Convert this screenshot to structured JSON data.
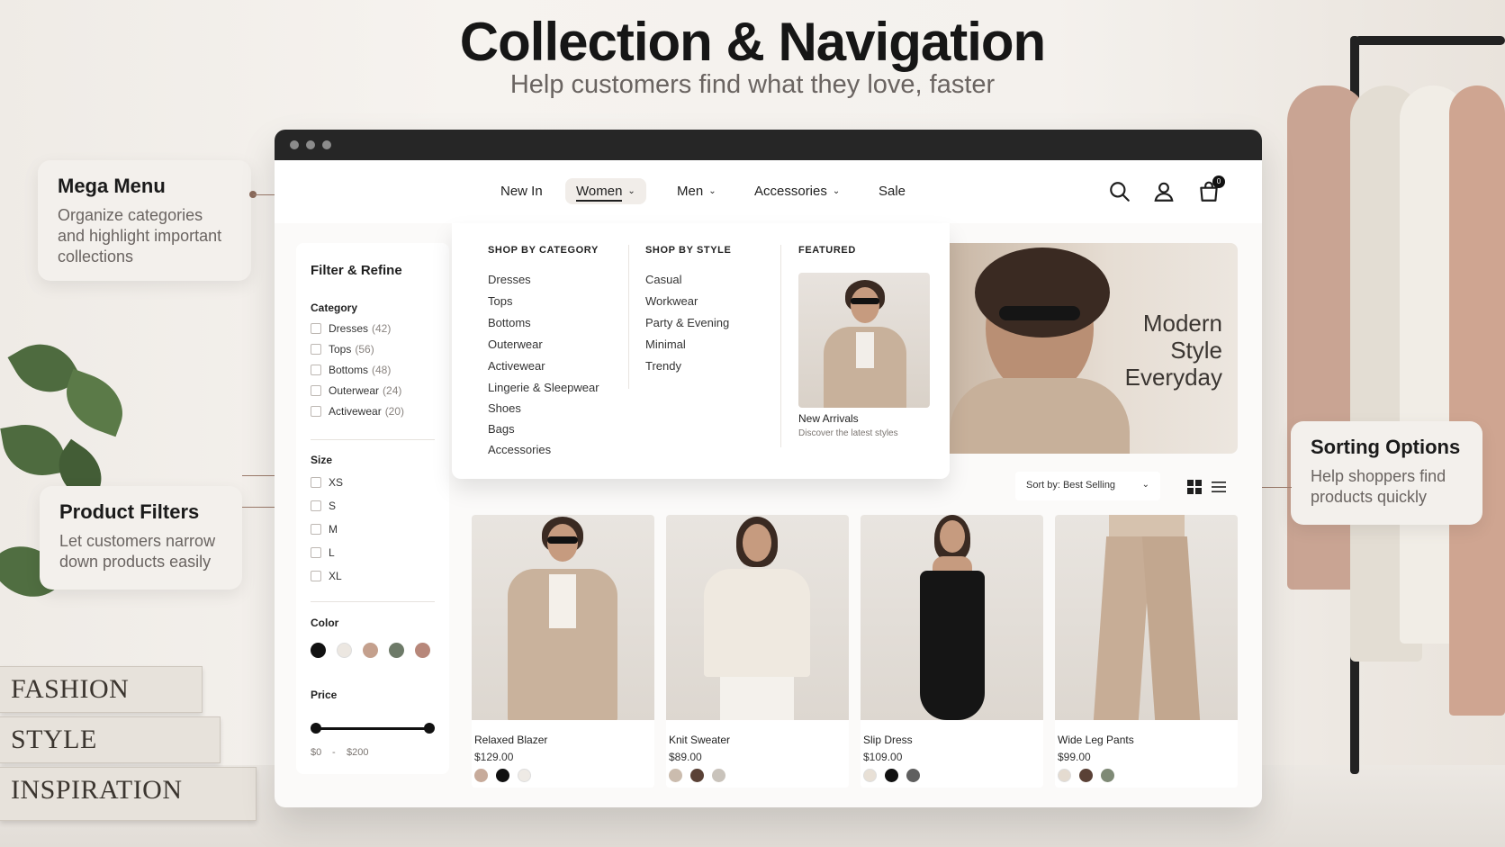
{
  "hero": {
    "title": "Collection & Navigation",
    "subtitle": "Help customers find what they love, faster"
  },
  "callouts": {
    "mega_menu": {
      "title": "Mega Menu",
      "text": "Organize categories and highlight important collections"
    },
    "filters": {
      "title": "Product Filters",
      "text": "Let customers narrow down products easily"
    },
    "sorting": {
      "title": "Sorting Options",
      "text": "Help shoppers find products quickly"
    }
  },
  "books": [
    "FASHION",
    "STYLE",
    "INSPIRATION"
  ],
  "nav": {
    "items": [
      {
        "label": "New In",
        "dropdown": false
      },
      {
        "label": "Women",
        "dropdown": true,
        "active": true
      },
      {
        "label": "Men",
        "dropdown": true
      },
      {
        "label": "Accessories",
        "dropdown": true
      },
      {
        "label": "Sale",
        "dropdown": false
      }
    ],
    "cart_count": "0",
    "icons": [
      "search-icon",
      "user-icon",
      "cart-icon"
    ]
  },
  "mega_menu": {
    "category_heading": "SHOP BY CATEGORY",
    "categories": [
      "Dresses",
      "Tops",
      "Bottoms",
      "Outerwear",
      "Activewear",
      "Lingerie & Sleepwear",
      "Shoes",
      "Bags",
      "Accessories"
    ],
    "style_heading": "SHOP BY STYLE",
    "styles": [
      "Casual",
      "Workwear",
      "Party & Evening",
      "Minimal",
      "Trendy"
    ],
    "featured_heading": "FEATURED",
    "featured_title": "New Arrivals",
    "featured_sub": "Discover the latest styles"
  },
  "banner": {
    "line1": "Modern",
    "line2": "Style",
    "line3": "Everyday"
  },
  "filters": {
    "title": "Filter & Refine",
    "category_heading": "Category",
    "categories": [
      {
        "label": "Dresses",
        "count": "(42)"
      },
      {
        "label": "Tops",
        "count": "(56)"
      },
      {
        "label": "Bottoms",
        "count": "(48)"
      },
      {
        "label": "Outerwear",
        "count": "(24)"
      },
      {
        "label": "Activewear",
        "count": "(20)"
      }
    ],
    "size_heading": "Size",
    "sizes": [
      "XS",
      "S",
      "M",
      "L",
      "XL"
    ],
    "color_heading": "Color",
    "colors": [
      "#111111",
      "#ece7e1",
      "#c4a08d",
      "#6d7a68",
      "#b7877a"
    ],
    "price_heading": "Price",
    "price_min": "$0",
    "price_sep": "-",
    "price_max": "$200"
  },
  "sort": {
    "label": "Sort by: Best Selling"
  },
  "products": [
    {
      "name": "Relaxed Blazer",
      "price": "$129.00",
      "swatches": [
        "#c7ab9b",
        "#111111",
        "#eeeae5"
      ]
    },
    {
      "name": "Knit Sweater",
      "price": "$89.00",
      "swatches": [
        "#cbbcae",
        "#5a4136",
        "#c9c3bb"
      ]
    },
    {
      "name": "Slip Dress",
      "price": "$109.00",
      "swatches": [
        "#e8e0d6",
        "#111111",
        "#5f5f5f"
      ]
    },
    {
      "name": "Wide Leg Pants",
      "price": "$99.00",
      "swatches": [
        "#e4dbd0",
        "#5a4136",
        "#7f8a76"
      ]
    }
  ],
  "accent_color": "#8a6a5b"
}
